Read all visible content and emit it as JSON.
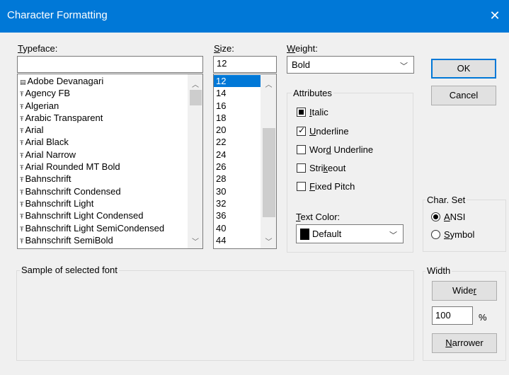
{
  "window": {
    "title": "Character Formatting",
    "close": "✕"
  },
  "typeface": {
    "label": "Typeface:",
    "value": "",
    "items": [
      {
        "glyph": "▤",
        "name": "Adobe Devanagari"
      },
      {
        "glyph": "Ŧ",
        "name": "Agency FB"
      },
      {
        "glyph": "Ŧ",
        "name": "Algerian"
      },
      {
        "glyph": "Ŧ",
        "name": "Arabic Transparent"
      },
      {
        "glyph": "Ŧ",
        "name": "Arial"
      },
      {
        "glyph": "Ŧ",
        "name": "Arial Black"
      },
      {
        "glyph": "Ŧ",
        "name": "Arial Narrow"
      },
      {
        "glyph": "Ŧ",
        "name": "Arial Rounded MT Bold"
      },
      {
        "glyph": "Ŧ",
        "name": "Bahnschrift"
      },
      {
        "glyph": "Ŧ",
        "name": "Bahnschrift Condensed"
      },
      {
        "glyph": "Ŧ",
        "name": "Bahnschrift Light"
      },
      {
        "glyph": "Ŧ",
        "name": "Bahnschrift Light Condensed"
      },
      {
        "glyph": "Ŧ",
        "name": "Bahnschrift Light SemiCondensed"
      },
      {
        "glyph": "Ŧ",
        "name": "Bahnschrift SemiBold"
      }
    ]
  },
  "size": {
    "label": "Size:",
    "value": "12",
    "items": [
      "12",
      "14",
      "16",
      "18",
      "20",
      "22",
      "24",
      "26",
      "28",
      "30",
      "32",
      "36",
      "40",
      "44"
    ],
    "selected": "12"
  },
  "weight": {
    "label": "Weight:",
    "value": "Bold"
  },
  "attributes": {
    "label": "Attributes",
    "italic": {
      "label": "Italic",
      "state": "indeterminate"
    },
    "underline": {
      "label": "Underline",
      "state": "checked"
    },
    "word_underline": {
      "label": "Word Underline",
      "state": "unchecked"
    },
    "strikeout": {
      "label": "Strikeout",
      "state": "unchecked"
    },
    "fixed_pitch": {
      "label": "Fixed Pitch",
      "state": "unchecked"
    },
    "text_color_label": "Text Color:",
    "text_color_value": "Default"
  },
  "buttons": {
    "ok": "OK",
    "cancel": "Cancel"
  },
  "charset": {
    "label": "Char. Set",
    "ansi": "ANSI",
    "symbol": "Symbol",
    "selected": "ANSI"
  },
  "sample": {
    "label": "Sample of selected font"
  },
  "width": {
    "label": "Width",
    "wider": "Wider",
    "value": "100",
    "unit": "%",
    "narrower": "Narrower"
  },
  "colors": {
    "accent": "#0078d7",
    "face": "#f0f0f0"
  }
}
